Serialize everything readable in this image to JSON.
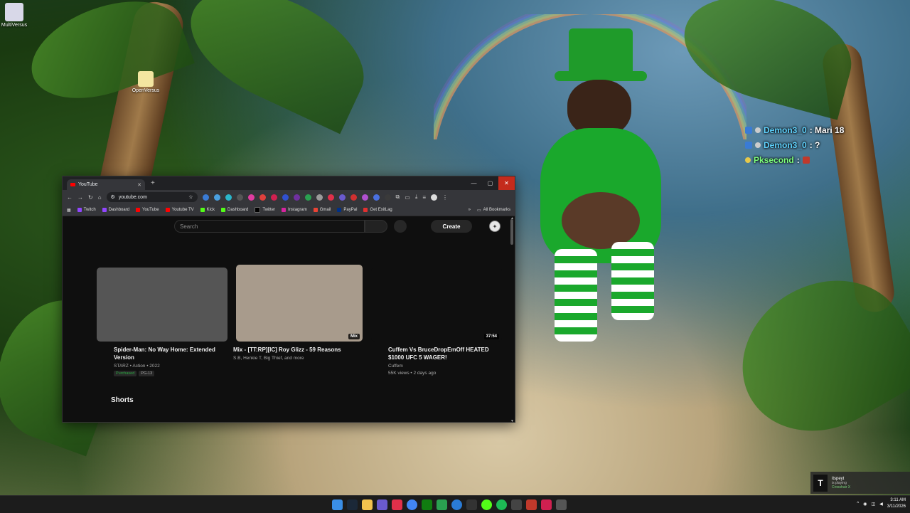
{
  "desktop": {
    "icons": [
      {
        "label": "MultiVersus"
      },
      {
        "label": "OpenVersus"
      }
    ]
  },
  "chat_overlay": {
    "lines": [
      {
        "user": "Demon3_0",
        "message": ": Mari 18"
      },
      {
        "user": "Demon3_0",
        "message": ": ?"
      },
      {
        "user": "Pksecond",
        "message": ":"
      }
    ]
  },
  "browser": {
    "tab_title": "YouTube",
    "new_tab": "+",
    "url": "youtube.com",
    "window_controls": {
      "minimize": "—",
      "maximize": "▢",
      "close": "✕"
    },
    "bookmarks": [
      "Twitch",
      "Dashboard",
      "YouTube",
      "Youtube TV",
      "Kick",
      "Dashboard",
      "Twitter",
      "Instagram",
      "Gmail",
      "PayPal",
      "Get ExitLag"
    ],
    "bookmarks_overflow": "»",
    "all_bookmarks": "All Bookmarks",
    "colors": {
      "accent": "#ff0000",
      "close": "#c42b1c"
    }
  },
  "youtube": {
    "search_placeholder": "Search",
    "create_label": "Create",
    "videos": [
      {
        "title": "Spider-Man: No Way Home: Extended Version",
        "meta": "STARZ • Action • 2022",
        "badges": [
          "Purchased",
          "PG-13"
        ],
        "duration": "",
        "thumb_color": "#555555"
      },
      {
        "title": "Mix - [TT:RP][IC] Roy Glizz - 59 Reasons",
        "meta": "S.B, Henkie T, Big Thief, and more",
        "badges": [],
        "duration": "Mix",
        "thumb_color": "#a89b8c"
      },
      {
        "title": "Cuffem Vs BruceDropEmOff HEATED $1000 UFC 5 WAGER!",
        "meta": "Cuffem",
        "meta2": "55K views • 2 days ago",
        "badges": [],
        "duration": "37:54",
        "thumb_color": "#0f0f0f"
      }
    ],
    "shorts_label": "Shorts"
  },
  "notification": {
    "title": "itspeyt",
    "status": "is playing",
    "game": "Crosshair X"
  },
  "taskbar": {
    "time": "3:11 AM",
    "date": "3/11/2026"
  }
}
